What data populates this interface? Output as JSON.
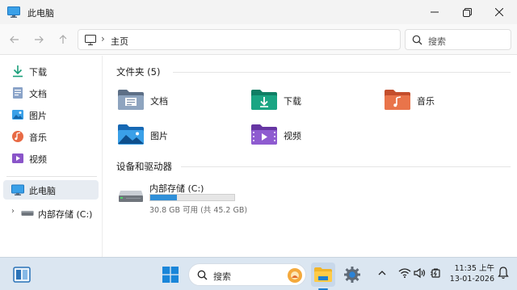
{
  "window": {
    "title": "此电脑",
    "controls": {
      "minimize": "minimize",
      "maximize": "maximize",
      "close": "close"
    }
  },
  "toolbar": {
    "back": "arrow-left-icon",
    "forward": "arrow-right-icon",
    "up": "arrow-up-icon",
    "breadcrumb": "主页",
    "search_placeholder": "搜索"
  },
  "sidebar": {
    "items": [
      {
        "label": "下载",
        "icon": "download-icon",
        "color": "#1a9f7a"
      },
      {
        "label": "文档",
        "icon": "document-icon",
        "color": "#6b89b8"
      },
      {
        "label": "图片",
        "icon": "pictures-icon",
        "color": "#2f8fd8"
      },
      {
        "label": "音乐",
        "icon": "music-icon",
        "color": "#e0643c"
      },
      {
        "label": "视频",
        "icon": "video-icon",
        "color": "#8a55c9"
      }
    ],
    "this_pc": "此电脑",
    "drive": "内部存储 (C:)"
  },
  "main": {
    "folders_title": "文件夹 (5)",
    "folders": [
      {
        "label": "文档",
        "icon": "documents-folder-icon"
      },
      {
        "label": "下载",
        "icon": "downloads-folder-icon"
      },
      {
        "label": "音乐",
        "icon": "music-folder-icon"
      },
      {
        "label": "图片",
        "icon": "pictures-folder-icon"
      },
      {
        "label": "视频",
        "icon": "videos-folder-icon"
      }
    ],
    "devices_title": "设备和驱动器",
    "drive": {
      "name": "内部存储 (C:)",
      "info": "30.8 GB 可用 (共 45.2 GB)",
      "used_fraction": 0.32
    }
  },
  "taskbar": {
    "search_label": "搜索",
    "time": "11:35 上午",
    "date": "13-01-2026"
  },
  "colors": {
    "accent": "#2f8fd8",
    "taskbar": "#dbe6f1"
  }
}
